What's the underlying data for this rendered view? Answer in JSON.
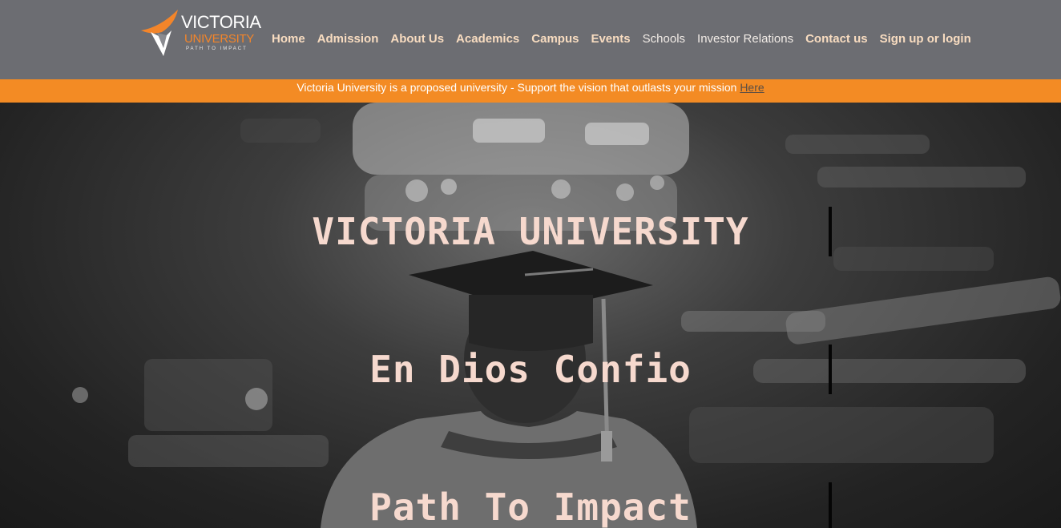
{
  "logo": {
    "title": "VICTORIA",
    "subtitle": "UNIVERSITY",
    "tagline": "PATH TO IMPACT",
    "accent_color": "#f3852a"
  },
  "nav": {
    "items": [
      {
        "label": "Home",
        "style": "bold"
      },
      {
        "label": "Admission",
        "style": "bold"
      },
      {
        "label": "About Us",
        "style": "bold"
      },
      {
        "label": "Academics",
        "style": "bold"
      },
      {
        "label": "Campus",
        "style": "bold"
      },
      {
        "label": "Events",
        "style": "bold"
      },
      {
        "label": "Schools",
        "style": "light"
      },
      {
        "label": "Investor Relations",
        "style": "light"
      },
      {
        "label": "Contact us",
        "style": "bold"
      },
      {
        "label": "Sign up or login",
        "style": "bold"
      }
    ]
  },
  "banner": {
    "text": "Victoria University is a proposed university - Support the vision that outlasts your mission",
    "link_label": "Here"
  },
  "hero": {
    "lines": [
      "VICTORIA UNIVERSITY",
      "En Dios Confio",
      "Path To Impact"
    ]
  },
  "colors": {
    "header_bg": "#6c6d72",
    "banner_bg": "#f38b24",
    "headline_text": "#f6d9ce"
  }
}
